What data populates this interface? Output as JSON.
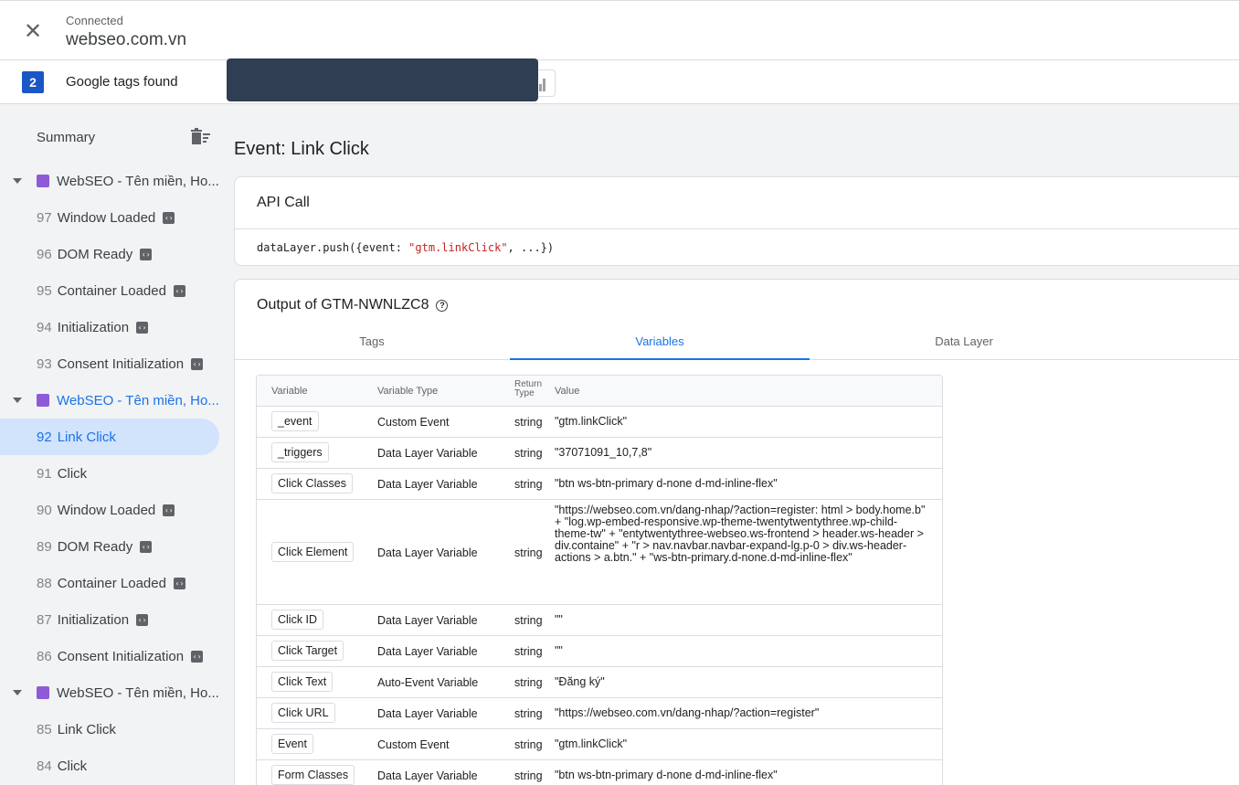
{
  "header": {
    "close_icon": "close-icon",
    "status": "Connected",
    "site": "webseo.com.vn"
  },
  "tagsbar": {
    "count": "2",
    "label": "Google tags found"
  },
  "sidebar": {
    "summary": "Summary",
    "groups": [
      {
        "title": "WebSEO - Tên miền, Ho...",
        "items": [
          {
            "num": "97",
            "label": "Window Loaded",
            "badge": true
          },
          {
            "num": "96",
            "label": "DOM Ready",
            "badge": true
          },
          {
            "num": "95",
            "label": "Container Loaded",
            "badge": true
          },
          {
            "num": "94",
            "label": "Initialization",
            "badge": true
          },
          {
            "num": "93",
            "label": "Consent Initialization",
            "badge": true
          }
        ]
      },
      {
        "title": "WebSEO - Tên miền, Ho...",
        "items": [
          {
            "num": "92",
            "label": "Link Click",
            "badge": false
          },
          {
            "num": "91",
            "label": "Click",
            "badge": false
          },
          {
            "num": "90",
            "label": "Window Loaded",
            "badge": true
          },
          {
            "num": "89",
            "label": "DOM Ready",
            "badge": true
          },
          {
            "num": "88",
            "label": "Container Loaded",
            "badge": true
          },
          {
            "num": "87",
            "label": "Initialization",
            "badge": true
          },
          {
            "num": "86",
            "label": "Consent Initialization",
            "badge": true
          }
        ]
      },
      {
        "title": "WebSEO - Tên miền, Ho...",
        "items": [
          {
            "num": "85",
            "label": "Link Click",
            "badge": false
          },
          {
            "num": "84",
            "label": "Click",
            "badge": false
          }
        ]
      }
    ]
  },
  "main": {
    "title": "Event: Link Click",
    "api": {
      "heading": "API Call",
      "code_pre": "dataLayer.push({event: ",
      "code_str": "\"gtm.linkClick\"",
      "code_post": ", ...})"
    },
    "output": {
      "heading": "Output of GTM-NWNLZC8",
      "tabs": [
        "Tags",
        "Variables",
        "Data Layer"
      ],
      "active_tab": "Variables",
      "columns": [
        "Variable",
        "Variable Type",
        "Return Type",
        "Value"
      ],
      "rows": [
        {
          "name": "_event",
          "type": "Custom Event",
          "ret": "string",
          "value": "\"gtm.linkClick\""
        },
        {
          "name": "_triggers",
          "type": "Data Layer Variable",
          "ret": "string",
          "value": "\"37071091_10,7,8\""
        },
        {
          "name": "Click Classes",
          "type": "Data Layer Variable",
          "ret": "string",
          "value": "\"btn ws-btn-primary d-none d-md-inline-flex\""
        },
        {
          "name": "Click Element",
          "type": "Data Layer Variable",
          "ret": "string",
          "value": "\"https://webseo.com.vn/dang-nhap/?action=register: html > body.home.b\" + \"log.wp-embed-responsive.wp-theme-twentytwentythree.wp-child-theme-tw\" + \"entytwentythree-webseo.ws-frontend > header.ws-header > div.containe\" + \"r > nav.navbar.navbar-expand-lg.p-0 > div.ws-header-actions > a.btn.\" + \"ws-btn-primary.d-none.d-md-inline-flex\""
        },
        {
          "name": "Click ID",
          "type": "Data Layer Variable",
          "ret": "string",
          "value": "\"\""
        },
        {
          "name": "Click Target",
          "type": "Data Layer Variable",
          "ret": "string",
          "value": "\"\""
        },
        {
          "name": "Click Text",
          "type": "Auto-Event Variable",
          "ret": "string",
          "value": "\"Đăng ký\""
        },
        {
          "name": "Click URL",
          "type": "Data Layer Variable",
          "ret": "string",
          "value": "\"https://webseo.com.vn/dang-nhap/?action=register\""
        },
        {
          "name": "Event",
          "type": "Custom Event",
          "ret": "string",
          "value": "\"gtm.linkClick\""
        },
        {
          "name": "Form Classes",
          "type": "Data Layer Variable",
          "ret": "string",
          "value": "\"btn ws-btn-primary d-none d-md-inline-flex\""
        }
      ]
    }
  }
}
